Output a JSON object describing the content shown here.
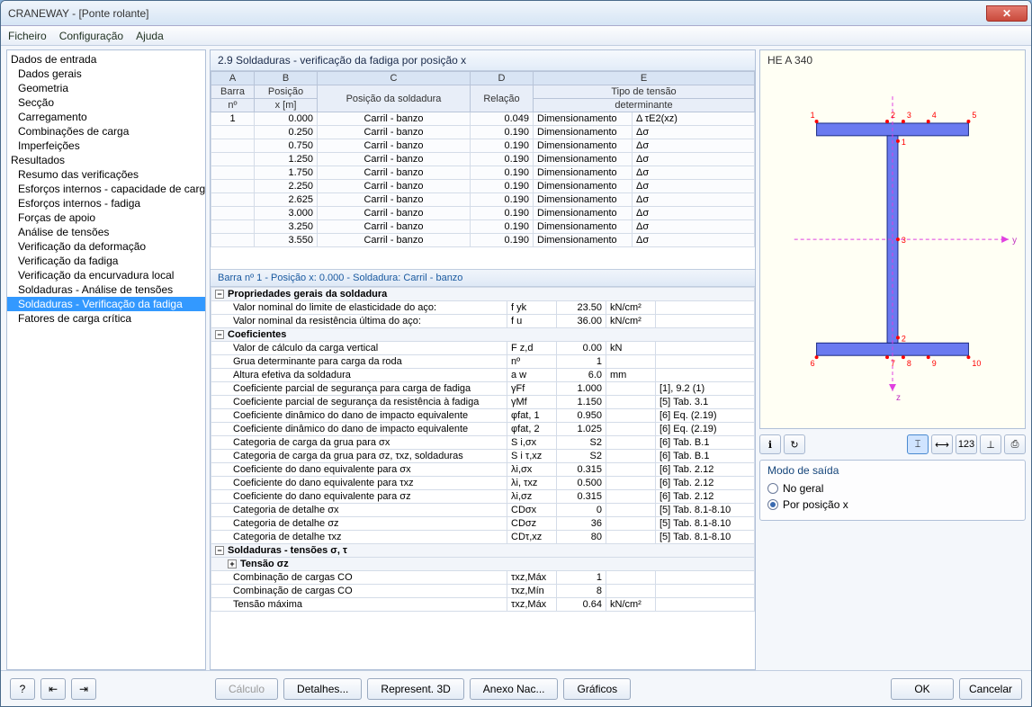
{
  "titlebar": {
    "title": "CRANEWAY - [Ponte rolante]"
  },
  "menu": {
    "file": "Ficheiro",
    "config": "Configuração",
    "help": "Ajuda"
  },
  "tree": {
    "input_root": "Dados de entrada",
    "input": [
      "Dados gerais",
      "Geometria",
      "Secção",
      "Carregamento",
      "Combinações de carga",
      "Imperfeições"
    ],
    "results_root": "Resultados",
    "results": [
      "Resumo das verificações",
      "Esforços internos - capacidade de carga",
      "Esforços internos - fadiga",
      "Forças de apoio",
      "Análise de tensões",
      "Verificação da deformação",
      "Verificação da fadiga",
      "Verificação da encurvadura local",
      "Soldaduras - Análise de tensões",
      "Soldaduras - Verificação da fadiga",
      "Fatores de carga crítica"
    ],
    "selected": "Soldaduras - Verificação da fadiga"
  },
  "section": {
    "title": "2.9 Soldaduras - verificação da fadiga por posição x"
  },
  "grid": {
    "colLetters": [
      "A",
      "B",
      "C",
      "D",
      "E"
    ],
    "headers": {
      "barra": "Barra",
      "no": "nº",
      "posx": "Posição",
      "xm": "x [m]",
      "possold": "Posição da soldadura",
      "rel": "Relação",
      "tipo": "Tipo de tensão",
      "det": "determinante"
    },
    "rows": [
      {
        "bar": "1",
        "x": "0.000",
        "pos": "Carril - banzo",
        "rel": "0.049",
        "tipo": "Δ τE2(xz)"
      },
      {
        "bar": "",
        "x": "0.250",
        "pos": "Carril - banzo",
        "rel": "0.190",
        "tipo": "Δσ"
      },
      {
        "bar": "",
        "x": "0.750",
        "pos": "Carril - banzo",
        "rel": "0.190",
        "tipo": "Δσ"
      },
      {
        "bar": "",
        "x": "1.250",
        "pos": "Carril - banzo",
        "rel": "0.190",
        "tipo": "Δσ"
      },
      {
        "bar": "",
        "x": "1.750",
        "pos": "Carril - banzo",
        "rel": "0.190",
        "tipo": "Δσ"
      },
      {
        "bar": "",
        "x": "2.250",
        "pos": "Carril - banzo",
        "rel": "0.190",
        "tipo": "Δσ"
      },
      {
        "bar": "",
        "x": "2.625",
        "pos": "Carril - banzo",
        "rel": "0.190",
        "tipo": "Δσ"
      },
      {
        "bar": "",
        "x": "3.000",
        "pos": "Carril - banzo",
        "rel": "0.190",
        "tipo": "Δσ"
      },
      {
        "bar": "",
        "x": "3.250",
        "pos": "Carril - banzo",
        "rel": "0.190",
        "tipo": "Δσ"
      },
      {
        "bar": "",
        "x": "3.550",
        "pos": "Carril - banzo",
        "rel": "0.190",
        "tipo": "Δσ"
      }
    ],
    "dimPrefix": "Dimensionamento"
  },
  "detailHeader": "Barra nº  1  -  Posição x:  0.000  -  Soldadura: Carril - banzo",
  "detail": {
    "cat1": "Propriedades gerais da soldadura",
    "rows1": [
      {
        "lbl": "Valor nominal do limite de elasticidade do aço:",
        "sym": "f yk",
        "val": "23.50",
        "unit": "kN/cm²",
        "ref": ""
      },
      {
        "lbl": "Valor nominal da resistência última do aço:",
        "sym": "f u",
        "val": "36.00",
        "unit": "kN/cm²",
        "ref": ""
      }
    ],
    "cat2": "Coeficientes",
    "rows2": [
      {
        "lbl": "Valor de cálculo da carga vertical",
        "sym": "F z,d",
        "val": "0.00",
        "unit": "kN",
        "ref": ""
      },
      {
        "lbl": "Grua determinante para carga da roda",
        "sym": "nº",
        "val": "1",
        "unit": "",
        "ref": ""
      },
      {
        "lbl": "Altura efetiva da soldadura",
        "sym": "a w",
        "val": "6.0",
        "unit": "mm",
        "ref": ""
      },
      {
        "lbl": "Coeficiente parcial de segurança para carga de fadiga",
        "sym": "γFf",
        "val": "1.000",
        "unit": "",
        "ref": "[1], 9.2 (1)"
      },
      {
        "lbl": "Coeficiente parcial de segurança da resistência à fadiga",
        "sym": "γMf",
        "val": "1.150",
        "unit": "",
        "ref": "[5] Tab. 3.1"
      },
      {
        "lbl": "Coeficiente dinâmico do dano de impacto equivalente",
        "sym": "φfat, 1",
        "val": "0.950",
        "unit": "",
        "ref": "[6] Eq. (2.19)"
      },
      {
        "lbl": "Coeficiente dinâmico do dano de impacto equivalente",
        "sym": "φfat, 2",
        "val": "1.025",
        "unit": "",
        "ref": "[6] Eq. (2.19)"
      },
      {
        "lbl": "Categoria de carga da grua para σx",
        "sym": "S i,σx",
        "val": "S2",
        "unit": "",
        "ref": "[6] Tab. B.1"
      },
      {
        "lbl": "Categoria de carga da grua para σz, τxz, soldaduras",
        "sym": "S i  τ,xz",
        "val": "S2",
        "unit": "",
        "ref": "[6] Tab. B.1"
      },
      {
        "lbl": "Coeficiente do dano equivalente para σx",
        "sym": "λi,σx",
        "val": "0.315",
        "unit": "",
        "ref": "[6] Tab. 2.12"
      },
      {
        "lbl": "Coeficiente do dano equivalente para τxz",
        "sym": "λi, τxz",
        "val": "0.500",
        "unit": "",
        "ref": "[6] Tab. 2.12"
      },
      {
        "lbl": "Coeficiente do dano equivalente para σz",
        "sym": "λi,σz",
        "val": "0.315",
        "unit": "",
        "ref": "[6] Tab. 2.12"
      },
      {
        "lbl": "Categoria de detalhe σx",
        "sym": "CDσx",
        "val": "0",
        "unit": "",
        "ref": "[5] Tab. 8.1-8.10"
      },
      {
        "lbl": "Categoria de detalhe σz",
        "sym": "CDσz",
        "val": "36",
        "unit": "",
        "ref": "[5] Tab. 8.1-8.10"
      },
      {
        "lbl": "Categoria de detalhe τxz",
        "sym": "CDτ,xz",
        "val": "80",
        "unit": "",
        "ref": "[5] Tab. 8.1-8.10"
      }
    ],
    "cat3": "Soldaduras - tensões σ, τ",
    "cat3a": "Tensão σz",
    "rows3": [
      {
        "lbl": "Combinação de cargas CO",
        "sym": "τxz,Máx",
        "val": "1",
        "unit": "",
        "ref": ""
      },
      {
        "lbl": "Combinação de cargas CO",
        "sym": "τxz,Mín",
        "val": "8",
        "unit": "",
        "ref": ""
      },
      {
        "lbl": "Tensão máxima",
        "sym": "τxz,Máx",
        "val": "0.64",
        "unit": "kN/cm²",
        "ref": ""
      }
    ]
  },
  "preview": {
    "profile": "HE A 340"
  },
  "mode": {
    "title": "Modo de saída",
    "general": "No geral",
    "byx": "Por posição x"
  },
  "footer": {
    "calc": "Cálculo",
    "details": "Detalhes...",
    "rep3d": "Represent. 3D",
    "anexo": "Anexo Nac...",
    "graf": "Gráficos",
    "ok": "OK",
    "cancel": "Cancelar"
  }
}
